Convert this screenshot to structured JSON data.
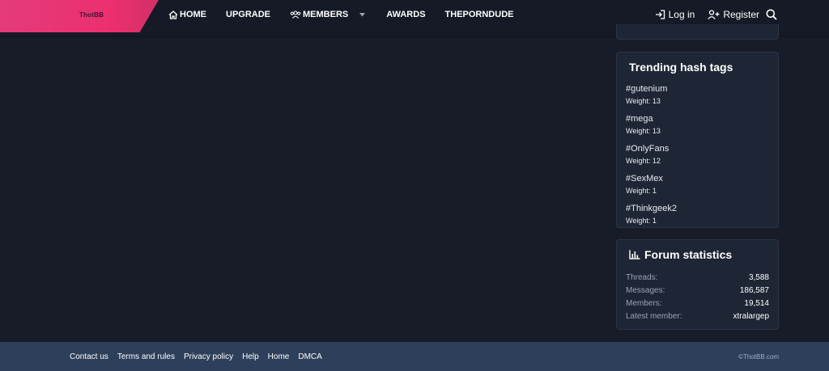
{
  "header": {
    "logo_text": "ThotBB",
    "nav": [
      {
        "label": "HOME"
      },
      {
        "label": "UPGRADE"
      },
      {
        "label": "MEMBERS"
      },
      {
        "label": "AWARDS"
      },
      {
        "label": "THEPORNDUDE"
      }
    ],
    "login_label": "Log in",
    "register_label": "Register"
  },
  "trending": {
    "title": "Trending hash tags",
    "tags": [
      {
        "name": "#gutenium",
        "weight": "Weight: 13"
      },
      {
        "name": "#mega",
        "weight": "Weight: 13"
      },
      {
        "name": "#OnlyFans",
        "weight": "Weight: 12"
      },
      {
        "name": "#SexMex",
        "weight": "Weight: 1"
      },
      {
        "name": "#Thinkgeek2",
        "weight": "Weight: 1"
      }
    ]
  },
  "stats": {
    "title": "Forum statistics",
    "rows": [
      {
        "label": "Threads:",
        "value": "3,588"
      },
      {
        "label": "Messages:",
        "value": "186,587"
      },
      {
        "label": "Members:",
        "value": "19,514"
      },
      {
        "label": "Latest member:",
        "value": "xtralargep"
      }
    ]
  },
  "footer": {
    "links": [
      {
        "label": "Contact us"
      },
      {
        "label": "Terms and rules"
      },
      {
        "label": "Privacy policy"
      },
      {
        "label": "Help"
      },
      {
        "label": "Home"
      },
      {
        "label": "DMCA"
      }
    ],
    "copyright": "©ThotBB.com"
  },
  "colors": {
    "brand_pink": "#ec2f6f",
    "background": "#171c28",
    "widget_bg": "#1e2635",
    "footer_bg": "#2e3f5a"
  },
  "icons": [
    "home-icon",
    "members-icon",
    "chevron-down-icon",
    "login-icon",
    "register-icon",
    "search-icon",
    "bar-chart-icon"
  ]
}
